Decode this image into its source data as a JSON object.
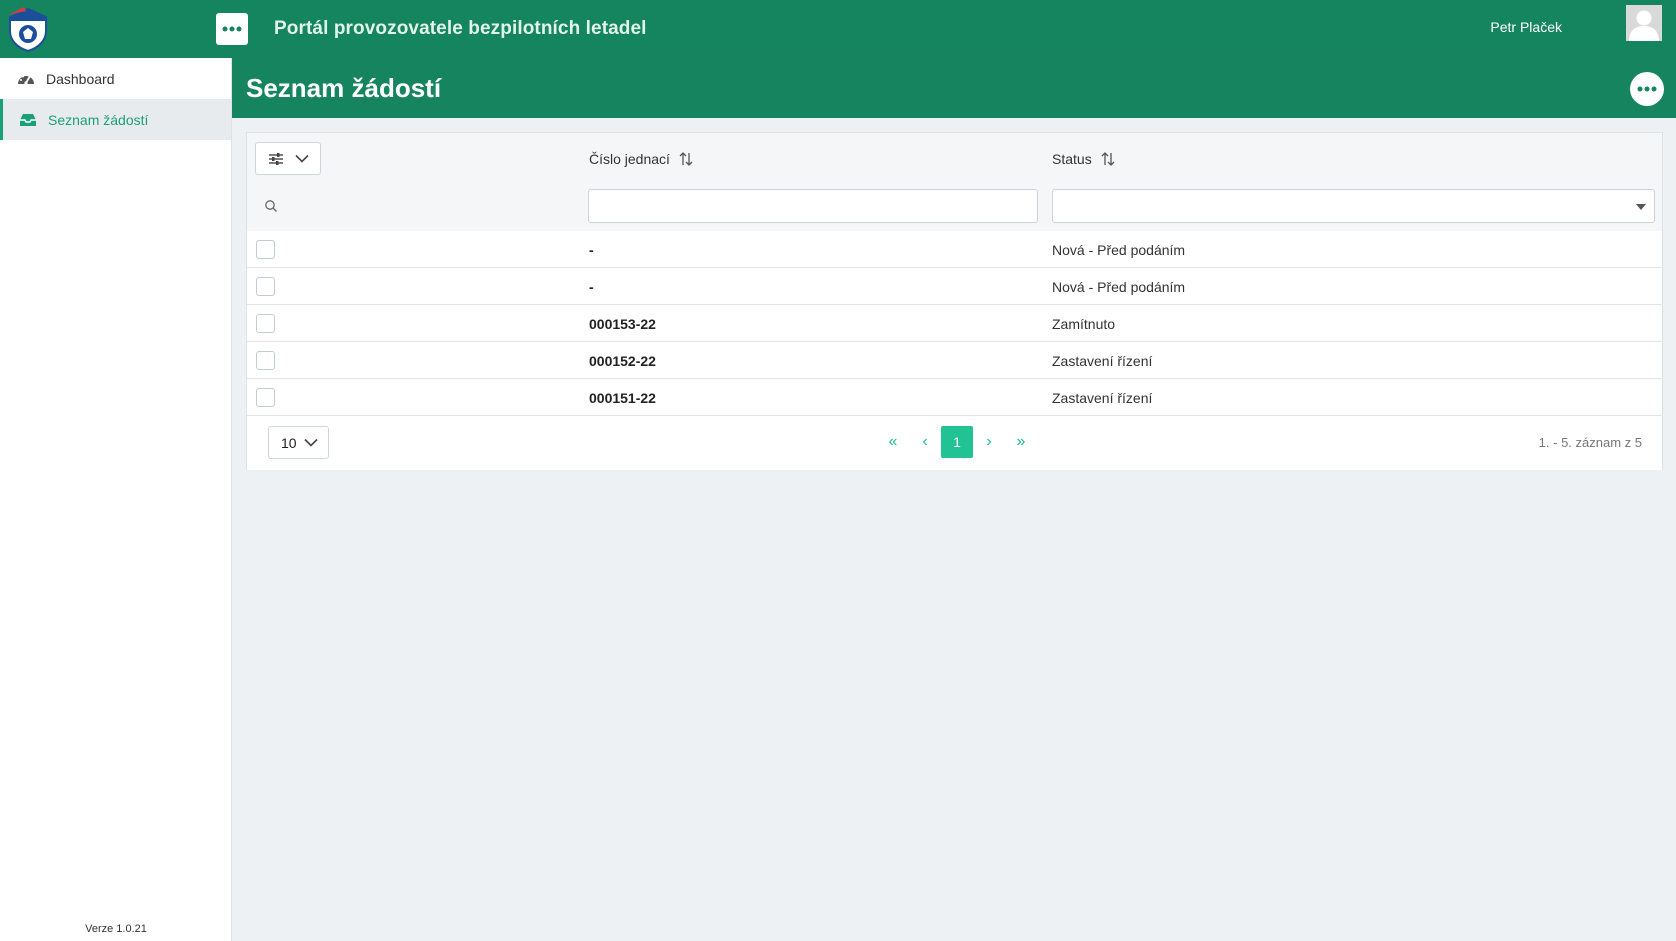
{
  "header": {
    "app_title": "Portál provozovatele bezpilotních letadel",
    "user_name": "Petr Plaček"
  },
  "sidebar": {
    "items": [
      {
        "label": "Dashboard",
        "icon": "gauge-icon",
        "active": false
      },
      {
        "label": "Seznam žádostí",
        "icon": "inbox-icon",
        "active": true
      }
    ],
    "version": "Verze 1.0.21"
  },
  "page": {
    "title": "Seznam žádostí"
  },
  "table": {
    "columns": [
      {
        "label": "Číslo jednací",
        "sortable": true
      },
      {
        "label": "Status",
        "sortable": true
      }
    ],
    "filters": {
      "number_value": "",
      "status_value": ""
    },
    "rows": [
      {
        "number": "-",
        "status": "Nová - Před podáním"
      },
      {
        "number": "-",
        "status": "Nová - Před podáním"
      },
      {
        "number": "000153-22",
        "status": "Zamítnuto"
      },
      {
        "number": "000152-22",
        "status": "Zastavení řízení"
      },
      {
        "number": "000151-22",
        "status": "Zastavení řízení"
      }
    ]
  },
  "pagination": {
    "page_size": "10",
    "current_page": "1",
    "first": "«",
    "prev": "‹",
    "next": "›",
    "last": "»",
    "records_label": "1. - 5. záznam z 5"
  },
  "colors": {
    "header_green": "#15855f",
    "accent": "#21c293",
    "active_text": "#1aa077"
  }
}
